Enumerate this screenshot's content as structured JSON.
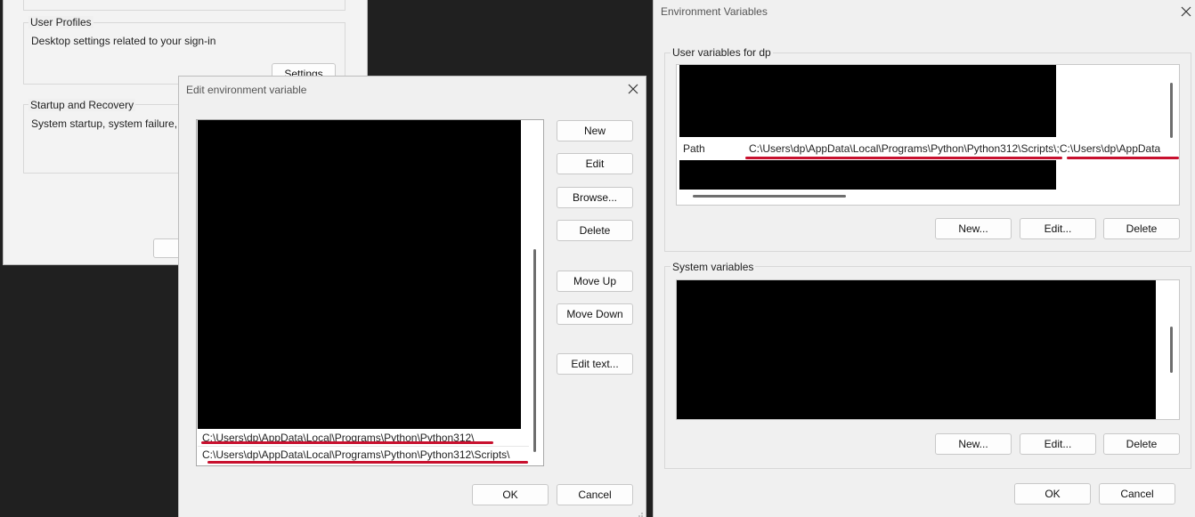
{
  "system_properties": {
    "user_profiles": {
      "label": "User Profiles",
      "description": "Desktop settings related to your sign-in",
      "settings_button": "Settings"
    },
    "startup_recovery": {
      "label": "Startup and Recovery",
      "description": "System startup, system failure, and d"
    }
  },
  "edit_dialog": {
    "title": "Edit environment variable",
    "entries": [
      "C:\\Users\\dp\\AppData\\Local\\Programs\\Python\\Python312\\",
      "C:\\Users\\dp\\AppData\\Local\\Programs\\Python\\Python312\\Scripts\\"
    ],
    "buttons": {
      "new": "New",
      "edit": "Edit",
      "browse": "Browse...",
      "delete": "Delete",
      "move_up": "Move Up",
      "move_down": "Move Down",
      "edit_text": "Edit text..."
    },
    "ok": "OK",
    "cancel": "Cancel"
  },
  "env_vars": {
    "title": "Environment Variables",
    "user_section": "User variables for dp",
    "path_row": {
      "name": "Path",
      "value": "C:\\Users\\dp\\AppData\\Local\\Programs\\Python\\Python312\\Scripts\\;C:\\Users\\dp\\AppData"
    },
    "user_buttons": {
      "new": "New...",
      "edit": "Edit...",
      "delete": "Delete"
    },
    "system_section": "System variables",
    "system_buttons": {
      "new": "New...",
      "edit": "Edit...",
      "delete": "Delete"
    },
    "ok": "OK",
    "cancel": "Cancel"
  },
  "colors": {
    "accent_underline": "#c8102e",
    "redaction": "#000000"
  }
}
